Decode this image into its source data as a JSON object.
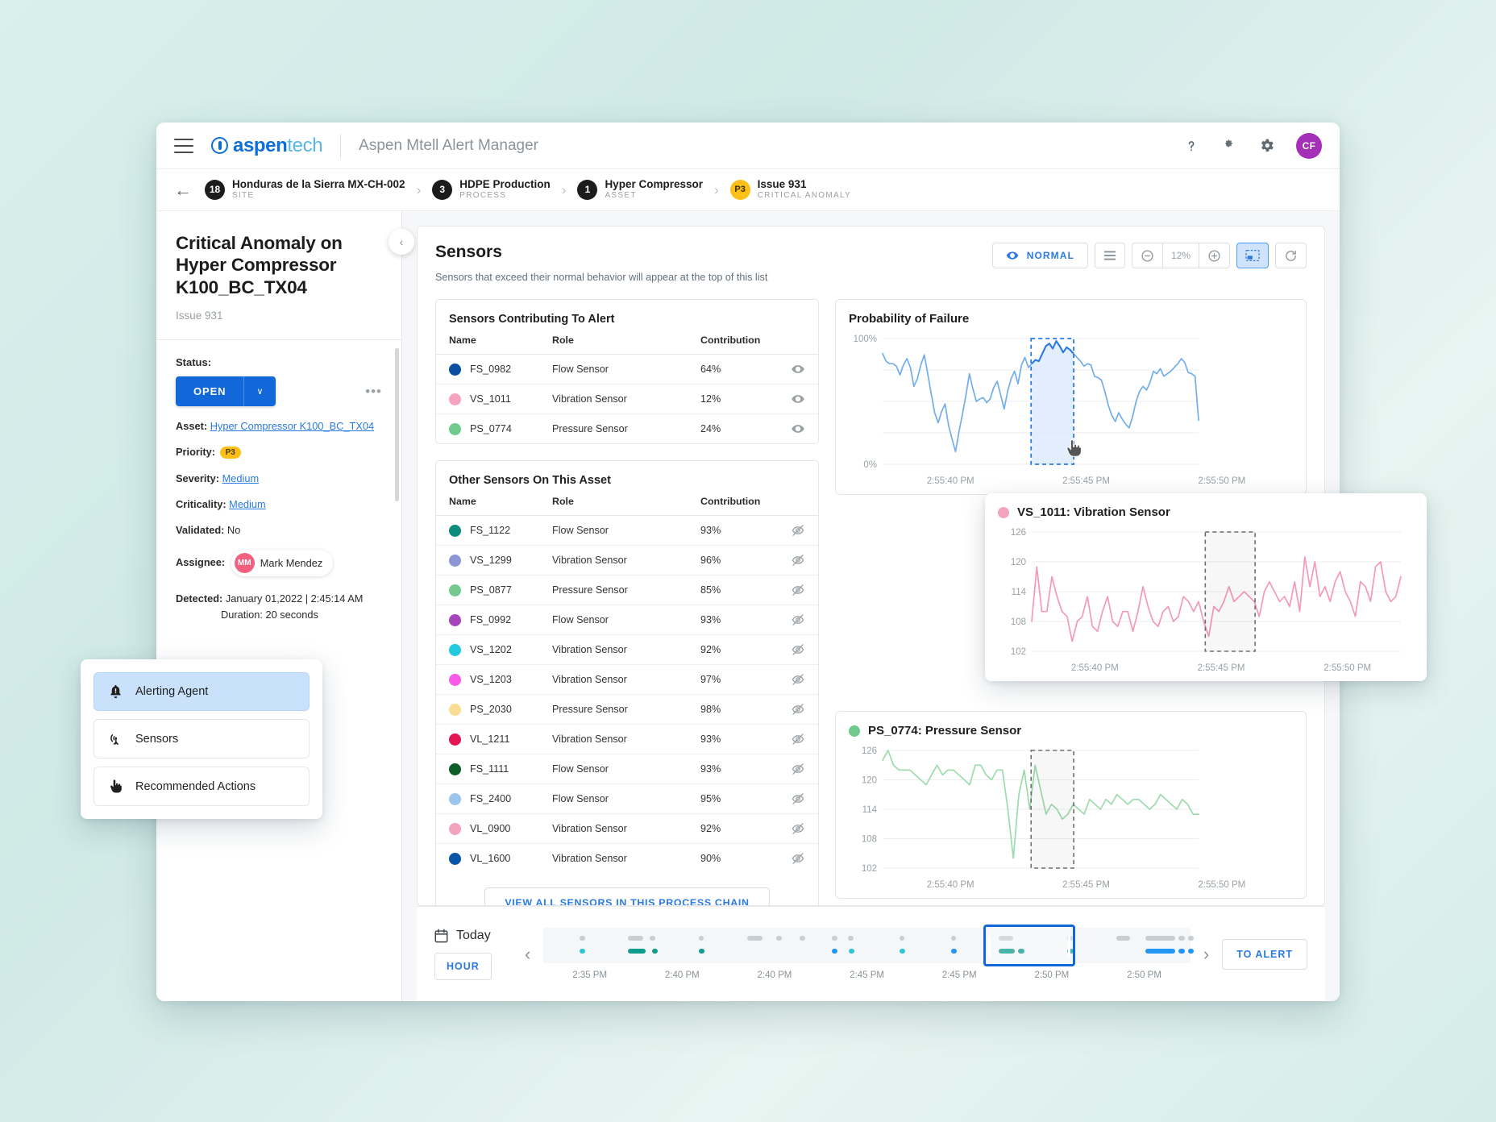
{
  "header": {
    "brand_primary": "aspen",
    "brand_secondary": "tech",
    "app_title": "Aspen Mtell Alert Manager",
    "icons": {
      "help": "?",
      "dark_mode": "dark-mode-toggle",
      "settings": "gear"
    },
    "avatar_initials": "CF"
  },
  "breadcrumb": [
    {
      "badge": "18",
      "name": "Honduras de la Sierra MX-CH-002",
      "sub": "SITE"
    },
    {
      "badge": "3",
      "name": "HDPE Production",
      "sub": "PROCESS"
    },
    {
      "badge": "1",
      "name": "Hyper Compressor",
      "sub": "ASSET"
    },
    {
      "badge": "P3",
      "name": "Issue 931",
      "sub": "CRITICAL ANOMALY"
    }
  ],
  "left_panel": {
    "title": "Critical Anomaly on Hyper Compressor K100_BC_TX04",
    "issue_id": "Issue 931",
    "status_label": "Status:",
    "status_value": "OPEN",
    "more_dots": "•••",
    "asset_label": "Asset:",
    "asset_value": "Hyper Compressor K100_BC_TX04",
    "priority_label": "Priority:",
    "priority_value": "P3",
    "severity_label": "Severity:",
    "severity_value": "Medium",
    "criticality_label": "Criticality:",
    "criticality_value": "Medium",
    "validated_label": "Validated:",
    "validated_value": "No",
    "assignee_label": "Assignee:",
    "assignee_initials": "MM",
    "assignee_name": "Mark Mendez",
    "detected_label": "Detected:",
    "detected_value": "January 01,2022 | 2:45:14 AM",
    "duration_value": "Duration: 20 seconds"
  },
  "floating_menu": {
    "items": [
      {
        "label": "Alerting Agent",
        "icon": "bell-icon",
        "active": true
      },
      {
        "label": "Sensors",
        "icon": "sensor-antenna-icon",
        "active": false
      },
      {
        "label": "Recommended Actions",
        "icon": "hand-pointer-icon",
        "active": false
      }
    ]
  },
  "main": {
    "title": "Sensors",
    "description": "Sensors that exceed their normal behavior will appear at the top of this list",
    "toolbar": {
      "normal_label": "NORMAL",
      "list_icon": "list-icon",
      "zoom_out": "−",
      "zoom_value": "12%",
      "zoom_in": "+",
      "select_tool": "selection-tool",
      "refresh": "refresh-icon"
    },
    "contributing": {
      "title": "Sensors Contributing To Alert",
      "columns": [
        "Name",
        "Role",
        "Contribution"
      ],
      "rows": [
        {
          "name": "FS_0982",
          "role": "Flow Sensor",
          "contribution": "64%",
          "color": "#0a4fa0",
          "visible": true
        },
        {
          "name": "VS_1011",
          "role": "Vibration Sensor",
          "contribution": "12%",
          "color": "#f4a5bd",
          "visible": true
        },
        {
          "name": "PS_0774",
          "role": "Pressure Sensor",
          "contribution": "24%",
          "color": "#6fca8c",
          "visible": true
        }
      ]
    },
    "other": {
      "title": "Other Sensors On This Asset",
      "columns": [
        "Name",
        "Role",
        "Contribution"
      ],
      "rows": [
        {
          "name": "FS_1122",
          "role": "Flow Sensor",
          "contribution": "93%",
          "color": "#0d8b7d",
          "visible": false
        },
        {
          "name": "VS_1299",
          "role": "Vibration Sensor",
          "contribution": "96%",
          "color": "#8d97d6",
          "visible": false
        },
        {
          "name": "PS_0877",
          "role": "Pressure Sensor",
          "contribution": "85%",
          "color": "#74c98e",
          "visible": false
        },
        {
          "name": "FS_0992",
          "role": "Flow Sensor",
          "contribution": "93%",
          "color": "#a843bb",
          "visible": false
        },
        {
          "name": "VS_1202",
          "role": "Vibration Sensor",
          "contribution": "92%",
          "color": "#23c9e0",
          "visible": false
        },
        {
          "name": "VS_1203",
          "role": "Vibration Sensor",
          "contribution": "97%",
          "color": "#f95ae8",
          "visible": false
        },
        {
          "name": "PS_2030",
          "role": "Pressure Sensor",
          "contribution": "98%",
          "color": "#fbdc93",
          "visible": false
        },
        {
          "name": "VL_1211",
          "role": "Vibration Sensor",
          "contribution": "93%",
          "color": "#e31553",
          "visible": false
        },
        {
          "name": "FS_1111",
          "role": "Flow Sensor",
          "contribution": "93%",
          "color": "#0c5e26",
          "visible": false
        },
        {
          "name": "FS_2400",
          "role": "Flow Sensor",
          "contribution": "95%",
          "color": "#9cc5ee",
          "visible": false
        },
        {
          "name": "VL_0900",
          "role": "Vibration Sensor",
          "contribution": "92%",
          "color": "#f2a3bf",
          "visible": false
        },
        {
          "name": "VL_1600",
          "role": "Vibration Sensor",
          "contribution": "90%",
          "color": "#0a55a8",
          "visible": false
        }
      ],
      "view_all_label": "VIEW ALL SENSORS IN THIS PROCESS CHAIN"
    }
  },
  "chart_data": [
    {
      "type": "line",
      "id": "probability-of-failure",
      "title": "Probability of Failure",
      "color": "#72aeea",
      "highlight_color": "#2a7ae2",
      "ylabel": "",
      "xlabel": "",
      "ytick_labels": [
        "100%",
        "0%"
      ],
      "ylim": [
        0,
        100
      ],
      "xtick_labels": [
        "2:55:40 PM",
        "2:55:45 PM",
        "2:55:50 PM"
      ],
      "grid": true,
      "selection": {
        "x_start_pct": 47.0,
        "x_end_pct": 60.5,
        "style": "dashed-blue"
      },
      "values": [
        88,
        82,
        80,
        80,
        78,
        71,
        79,
        84,
        77,
        62,
        68,
        79,
        87,
        72,
        56,
        41,
        33,
        42,
        48,
        31,
        20,
        10,
        26,
        40,
        55,
        72,
        60,
        50,
        52,
        53,
        49,
        52,
        61,
        66,
        55,
        44,
        58,
        68,
        74,
        64,
        79,
        85,
        77,
        80,
        83,
        82,
        88,
        94,
        96,
        92,
        98,
        94,
        89,
        93,
        91,
        88,
        85,
        82,
        78,
        80,
        79,
        70,
        69,
        67,
        58,
        47,
        39,
        34,
        41,
        36,
        32,
        29,
        38,
        50,
        58,
        62,
        59,
        65,
        74,
        72,
        76,
        70,
        72,
        74,
        77,
        80,
        84,
        81,
        73,
        72,
        70,
        35
      ]
    },
    {
      "type": "line",
      "id": "vs-1011-vibration",
      "title": "VS_1011: Vibration Sensor",
      "color": "#f49ab6",
      "dot_color": "#f4a5bd",
      "ylabel": "",
      "xlabel": "",
      "ytick_labels": [
        "126",
        "120",
        "114",
        "108",
        "102"
      ],
      "ylim": [
        102,
        126
      ],
      "xtick_labels": [
        "2:55:40 PM",
        "2:55:45 PM",
        "2:55:50 PM"
      ],
      "grid": true,
      "selection": {
        "x_start_pct": 47.0,
        "x_end_pct": 60.5,
        "style": "dashed-gray"
      },
      "values": [
        108,
        119,
        110,
        110,
        117,
        113,
        110,
        109,
        104,
        108,
        109,
        113,
        107,
        106,
        110,
        113,
        108,
        107,
        110,
        110,
        106,
        110,
        115,
        111,
        108,
        107,
        110,
        111,
        108,
        109,
        113,
        112,
        110,
        112,
        108,
        105,
        111,
        110,
        112,
        115,
        112,
        113,
        114,
        113,
        112,
        109,
        114,
        116,
        114,
        112,
        113,
        111,
        116,
        110,
        121,
        115,
        120,
        113,
        115,
        112,
        116,
        118,
        114,
        112,
        109,
        116,
        115,
        112,
        119,
        120,
        114,
        112,
        113,
        117
      ]
    },
    {
      "type": "line",
      "id": "ps-0774-pressure",
      "title": "PS_0774: Pressure Sensor",
      "color": "#9ddbae",
      "dot_color": "#6fca8c",
      "ylabel": "",
      "xlabel": "",
      "ytick_labels": [
        "126",
        "120",
        "114",
        "108",
        "102"
      ],
      "ylim": [
        102,
        126
      ],
      "xtick_labels": [
        "2:55:40 PM",
        "2:55:45 PM",
        "2:55:50 PM"
      ],
      "grid": true,
      "selection": {
        "x_start_pct": 47.0,
        "x_end_pct": 60.5,
        "style": "dashed-gray"
      },
      "values": [
        124,
        126,
        123,
        122,
        122,
        122,
        121,
        120,
        119,
        121,
        123,
        121,
        122,
        122,
        121,
        120,
        119,
        123,
        123,
        121,
        120,
        122,
        122,
        114,
        104,
        117,
        122,
        114,
        123,
        118,
        113,
        115,
        114,
        112,
        113,
        115,
        114,
        113,
        116,
        115,
        114,
        116,
        115,
        117,
        116,
        115,
        116,
        116,
        115,
        114,
        115,
        117,
        116,
        115,
        114,
        116,
        115,
        113,
        113
      ]
    }
  ],
  "timeline": {
    "today_label": "Today",
    "hour_label": "HOUR",
    "prev_arrow": "‹",
    "next_arrow": "›",
    "tick_labels": [
      "2:35 PM",
      "2:40 PM",
      "2:40 PM",
      "2:45 PM",
      "2:45 PM",
      "2:50 PM",
      "2:50 PM"
    ],
    "to_alert_label": "TO ALERT"
  }
}
